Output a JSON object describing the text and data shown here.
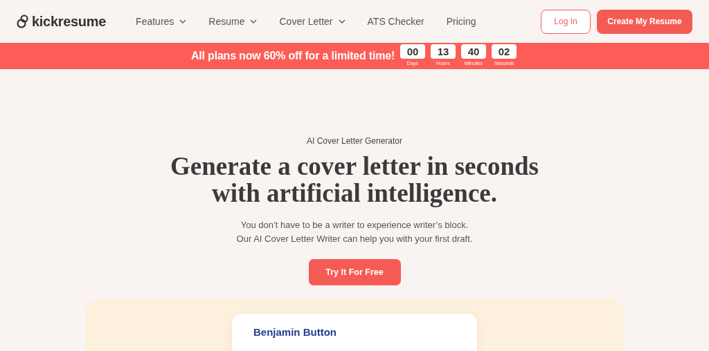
{
  "header": {
    "logo": "kickresume",
    "nav": [
      {
        "label": "Features",
        "dropdown": true
      },
      {
        "label": "Resume",
        "dropdown": true
      },
      {
        "label": "Cover Letter",
        "dropdown": true
      },
      {
        "label": "ATS Checker",
        "dropdown": false
      },
      {
        "label": "Pricing",
        "dropdown": false
      }
    ],
    "login": "Log In",
    "cta": "Create My Resume"
  },
  "banner": {
    "text": "All plans now 60% off for a limited time!",
    "countdown": [
      {
        "value": "00",
        "unit": "Days"
      },
      {
        "value": "13",
        "unit": "Hours"
      },
      {
        "value": "40",
        "unit": "Minutes"
      },
      {
        "value": "02",
        "unit": "Seconds"
      }
    ]
  },
  "hero": {
    "eyebrow": "AI Cover Letter Generator",
    "headline": [
      "Generate a cover letter in seconds",
      "with artificial intelligence."
    ],
    "description": [
      "You don’t have to be a writer to experience writer’s block.",
      "Our AI Cover Letter Writer can help you with your first draft."
    ],
    "button": "Try It For Free",
    "preview": {
      "name": "Benjamin Button"
    }
  }
}
